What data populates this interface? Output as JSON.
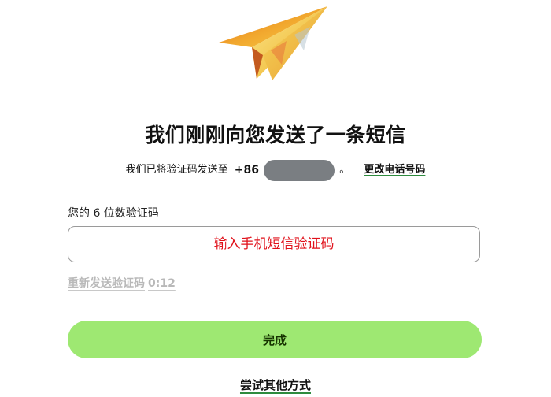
{
  "illustration": {
    "icon": "paper-plane-icon"
  },
  "title": "我们刚刚向您发送了一条短信",
  "sent_message": {
    "prefix": "我们已将验证码发送至",
    "phone_prefix": "+86",
    "period": "。",
    "change_link": "更改电话号码"
  },
  "code_field": {
    "label": "您的 6 位数验证码",
    "placeholder": "输入手机短信验证码"
  },
  "resend": {
    "label": "重新发送验证码",
    "countdown": "0:12"
  },
  "done_button": "完成",
  "other_methods_link": "尝试其他方式",
  "colors": {
    "primary_button": "#9ee872",
    "link_underline": "#2e8b3e",
    "placeholder_text": "#e0101a",
    "disabled_text": "#b9b9b9"
  }
}
